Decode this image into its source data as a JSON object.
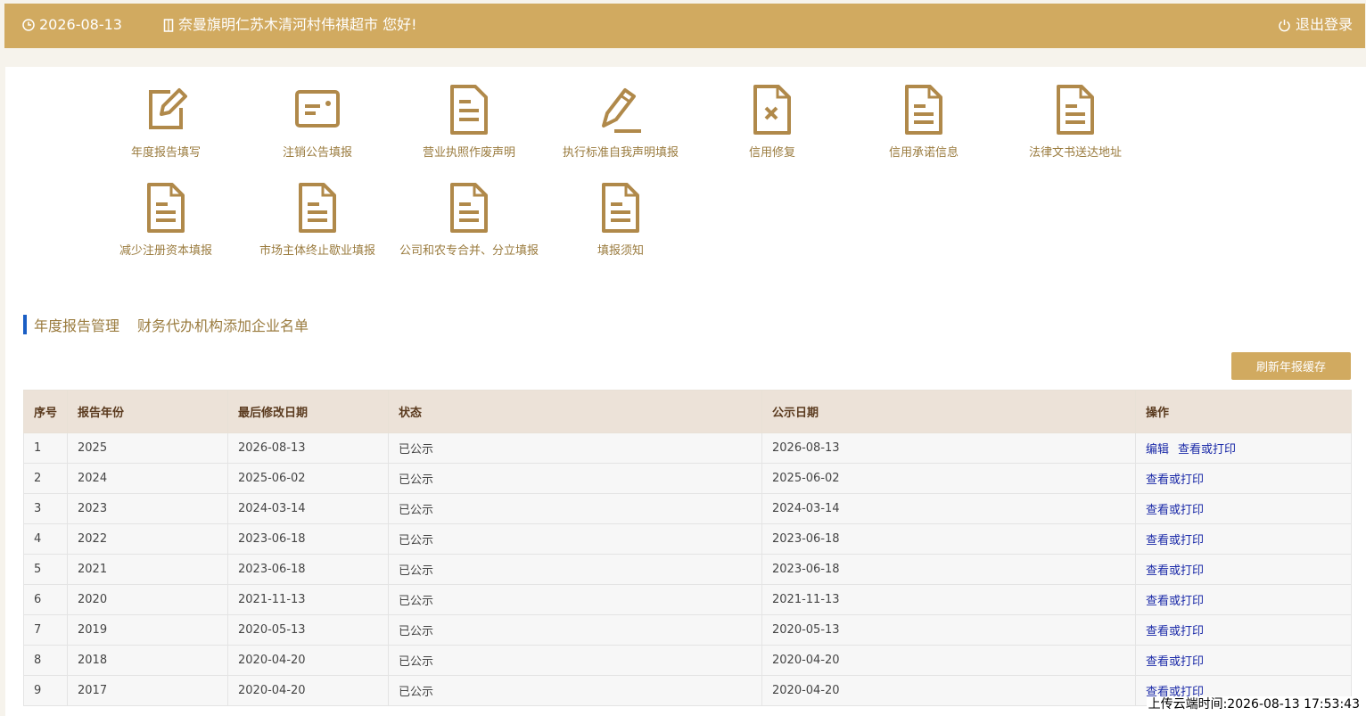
{
  "topbar": {
    "date": "2026-08-13",
    "greeting": "奈曼旗明仁苏木清河村伟祺超市 您好!",
    "logout_label": "退出登录"
  },
  "functions": [
    {
      "label": "年度报告填写",
      "icon": "edit-icon"
    },
    {
      "label": "注销公告填报",
      "icon": "card-icon"
    },
    {
      "label": "营业执照作废声明",
      "icon": "document-icon"
    },
    {
      "label": "执行标准自我声明填报",
      "icon": "pencil-icon"
    },
    {
      "label": "信用修复",
      "icon": "document-x-icon"
    },
    {
      "label": "信用承诺信息",
      "icon": "document-icon"
    },
    {
      "label": "法律文书送达地址",
      "icon": "document-icon"
    },
    {
      "label": "减少注册资本填报",
      "icon": "document-icon"
    },
    {
      "label": "市场主体终止歇业填报",
      "icon": "document-icon"
    },
    {
      "label": "公司和农专合并、分立填报",
      "icon": "document-icon"
    },
    {
      "label": "填报须知",
      "icon": "document-icon"
    }
  ],
  "tabs": [
    "年度报告管理",
    "财务代办机构添加企业名单"
  ],
  "refresh_label": "刷新年报缓存",
  "table": {
    "headers": [
      "序号",
      "报告年份",
      "最后修改日期",
      "状态",
      "公示日期",
      "操作"
    ],
    "rows": [
      {
        "no": "1",
        "year": "2025",
        "modified": "2026-08-13",
        "status": "已公示",
        "published": "2026-08-13",
        "actions": [
          "编辑",
          "查看或打印"
        ]
      },
      {
        "no": "2",
        "year": "2024",
        "modified": "2025-06-02",
        "status": "已公示",
        "published": "2025-06-02",
        "actions": [
          "查看或打印"
        ]
      },
      {
        "no": "3",
        "year": "2023",
        "modified": "2024-03-14",
        "status": "已公示",
        "published": "2024-03-14",
        "actions": [
          "查看或打印"
        ]
      },
      {
        "no": "4",
        "year": "2022",
        "modified": "2023-06-18",
        "status": "已公示",
        "published": "2023-06-18",
        "actions": [
          "查看或打印"
        ]
      },
      {
        "no": "5",
        "year": "2021",
        "modified": "2023-06-18",
        "status": "已公示",
        "published": "2023-06-18",
        "actions": [
          "查看或打印"
        ]
      },
      {
        "no": "6",
        "year": "2020",
        "modified": "2021-11-13",
        "status": "已公示",
        "published": "2021-11-13",
        "actions": [
          "查看或打印"
        ]
      },
      {
        "no": "7",
        "year": "2019",
        "modified": "2020-05-13",
        "status": "已公示",
        "published": "2020-05-13",
        "actions": [
          "查看或打印"
        ]
      },
      {
        "no": "8",
        "year": "2018",
        "modified": "2020-04-20",
        "status": "已公示",
        "published": "2020-04-20",
        "actions": [
          "查看或打印"
        ]
      },
      {
        "no": "9",
        "year": "2017",
        "modified": "2020-04-20",
        "status": "已公示",
        "published": "2020-04-20",
        "actions": [
          "查看或打印"
        ]
      }
    ]
  },
  "upload_time": "上传云端时间:2026-08-13 17:53:43"
}
